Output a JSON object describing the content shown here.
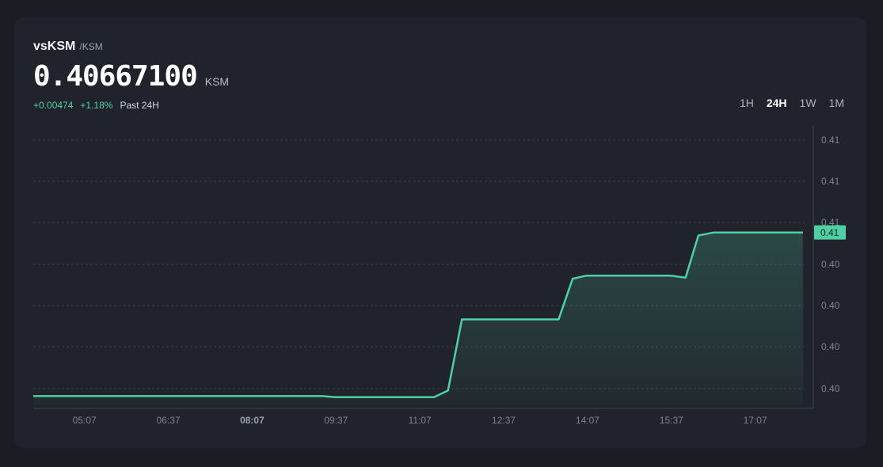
{
  "header": {
    "symbol": "vsKSM",
    "quote": "/KSM",
    "price": "0.40667100",
    "unit": "KSM",
    "change_abs": "+0.00474",
    "change_pct": "+1.18%",
    "change_period": "Past 24H"
  },
  "ranges": [
    {
      "label": "1H",
      "active": false
    },
    {
      "label": "24H",
      "active": true
    },
    {
      "label": "1W",
      "active": false
    },
    {
      "label": "1M",
      "active": false
    }
  ],
  "colors": {
    "line": "#4fcfa4",
    "positive": "#4fcfa4",
    "background": "#20232b",
    "grid": "#3a3e48",
    "axis_text": "#7d828d"
  },
  "chart_data": {
    "type": "area",
    "x_ticks": [
      "05:07",
      "06:37",
      "08:07",
      "09:37",
      "11:07",
      "12:37",
      "14:07",
      "15:37",
      "17:07"
    ],
    "x_ticks_bold": [
      "08:07"
    ],
    "y_tick_labels": [
      "0.41",
      "0.41",
      "0.41",
      "0.40",
      "0.40",
      "0.40",
      "0.40"
    ],
    "current_value_label": "0.41",
    "x_range_hours": [
      4.2,
      18.0
    ],
    "y_range": [
      0.40175,
      0.4072
    ],
    "x_hours": [
      4.2,
      9.37,
      9.6,
      11.37,
      11.62,
      11.87,
      13.6,
      13.85,
      14.1,
      15.6,
      15.87,
      16.1,
      16.37,
      17.97
    ],
    "y": [
      0.40193,
      0.40193,
      0.40191,
      0.40191,
      0.40204,
      0.40344,
      0.40344,
      0.40424,
      0.4043,
      0.4043,
      0.40426,
      0.40509,
      0.40515,
      0.40515
    ],
    "grid": true,
    "legend": "none"
  }
}
